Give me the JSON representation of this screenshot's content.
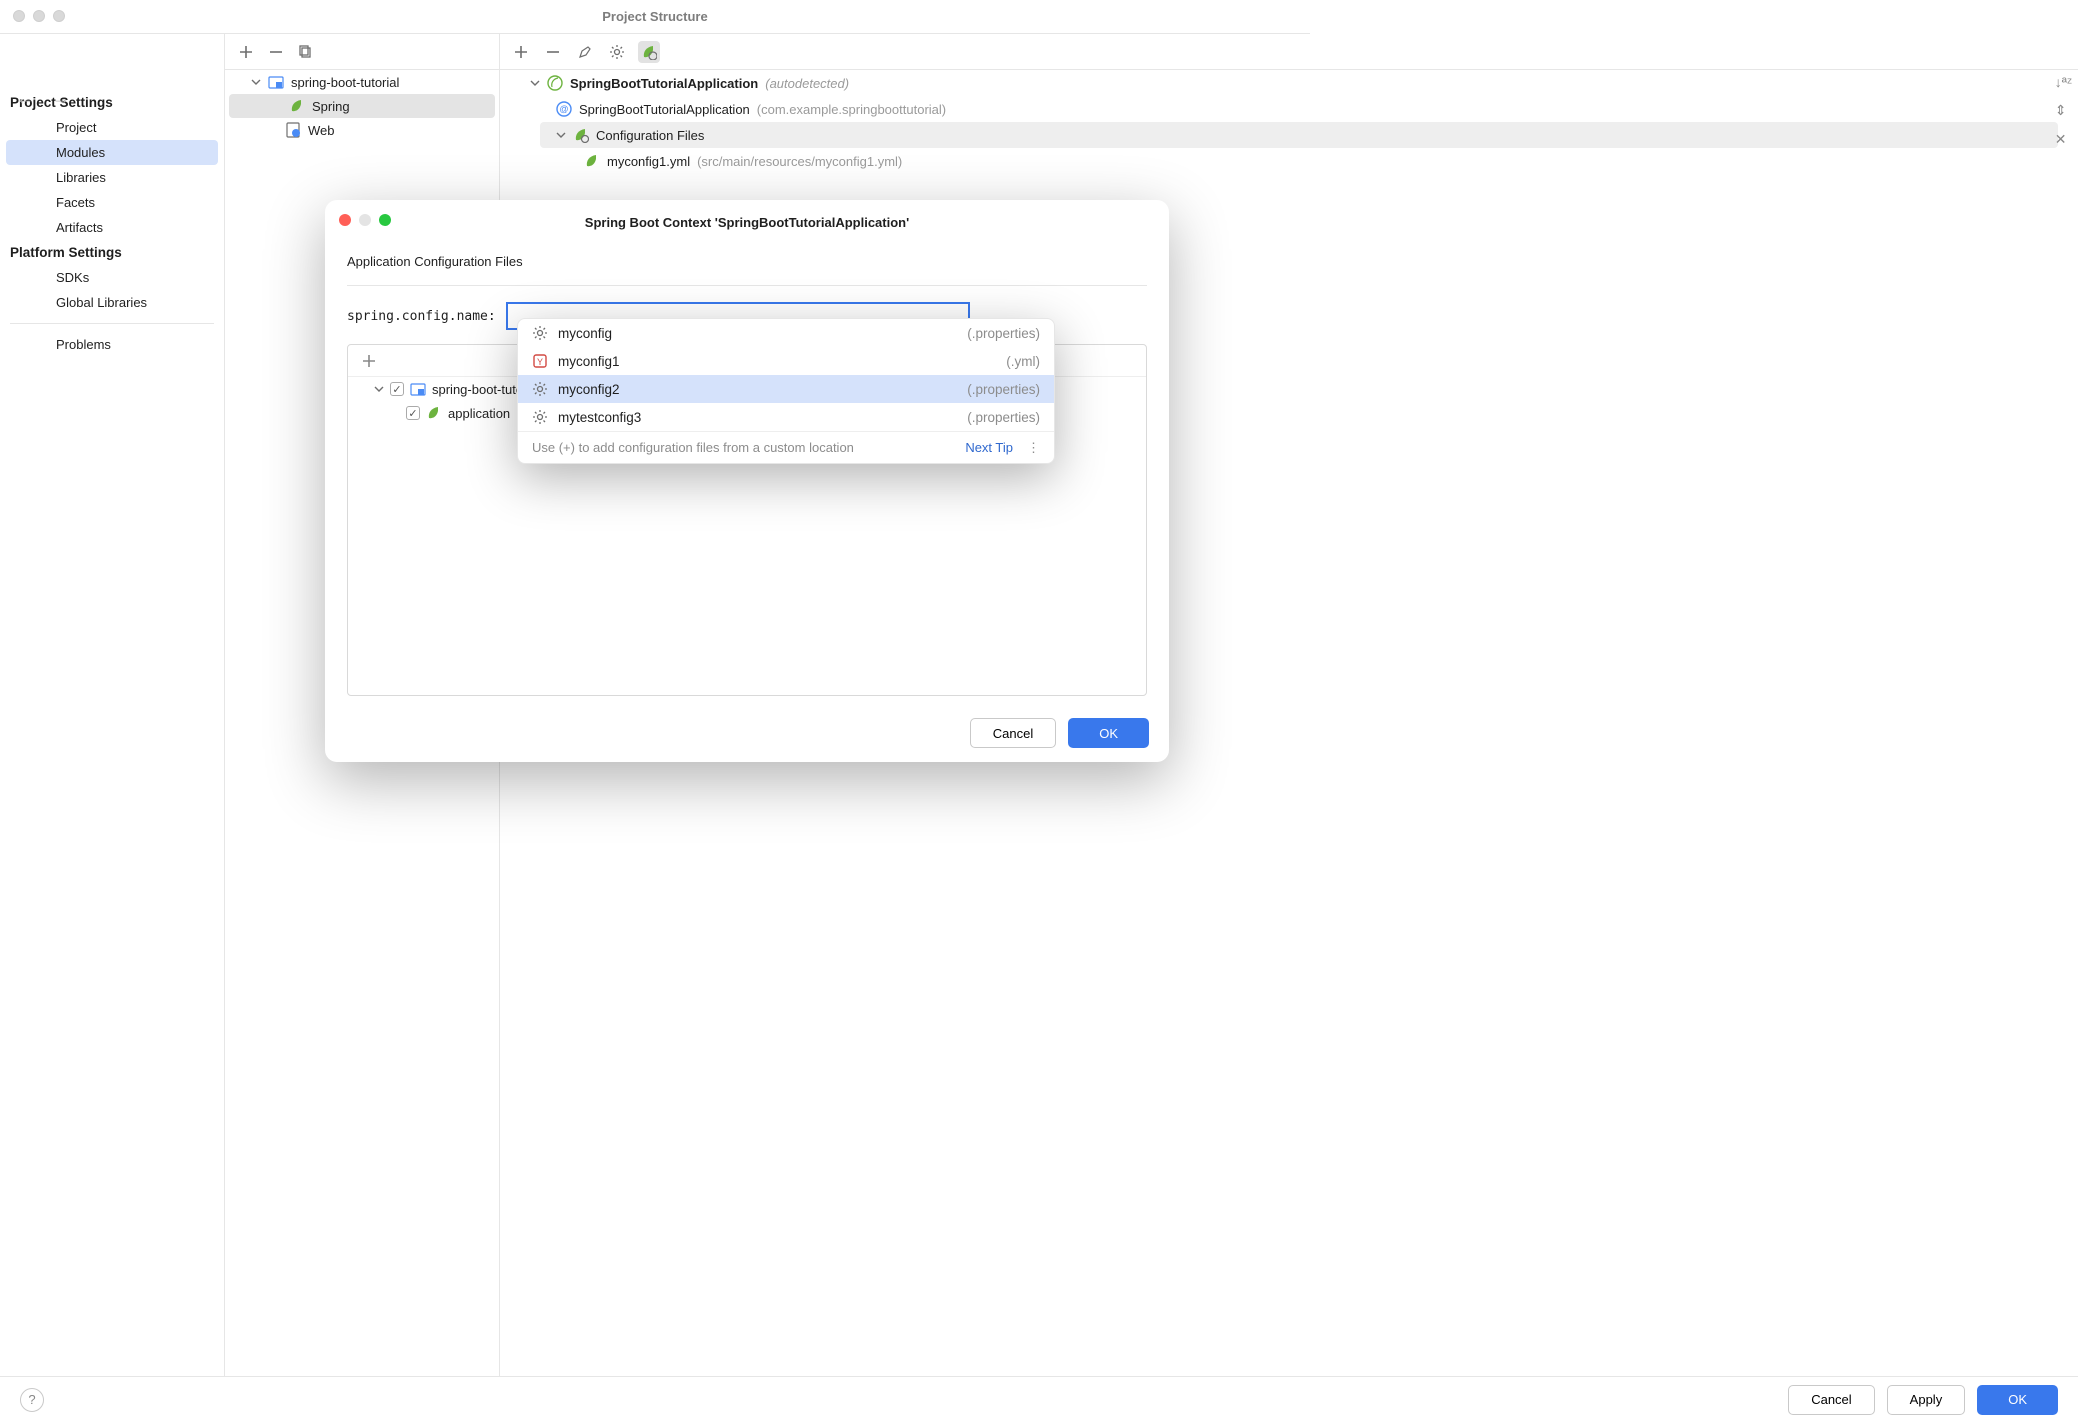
{
  "window": {
    "title": "Project Structure"
  },
  "sidebar": {
    "project_settings_heading": "Project Settings",
    "platform_settings_heading": "Platform Settings",
    "items": {
      "project": "Project",
      "modules": "Modules",
      "libraries": "Libraries",
      "facets": "Facets",
      "artifacts": "Artifacts",
      "sdks": "SDKs",
      "global_libraries": "Global Libraries",
      "problems": "Problems"
    }
  },
  "middle_tree": {
    "root": "spring-boot-tutorial",
    "items": [
      "Spring",
      "Web"
    ]
  },
  "detail": {
    "app_name": "SpringBootTutorialApplication",
    "app_suffix": "(autodetected)",
    "child_name": "SpringBootTutorialApplication",
    "child_pkg": "(com.example.springboottutorial)",
    "config_files_label": "Configuration Files",
    "file_name": "myconfig1.yml",
    "file_path": "(src/main/resources/myconfig1.yml)"
  },
  "modal": {
    "title": "Spring Boot Context 'SpringBootTutorialApplication'",
    "section_label": "Application Configuration Files",
    "config_label": "spring.config.name:",
    "config_value": "",
    "tree_root": "spring-boot-tutorial",
    "tree_file": "application",
    "cancel": "Cancel",
    "ok": "OK"
  },
  "autocomplete": {
    "items": [
      {
        "name": "myconfig",
        "ext": "(.properties)",
        "icon": "gear"
      },
      {
        "name": "myconfig1",
        "ext": "(.yml)",
        "icon": "yml"
      },
      {
        "name": "myconfig2",
        "ext": "(.properties)",
        "icon": "gear",
        "selected": true
      },
      {
        "name": "mytestconfig3",
        "ext": "(.properties)",
        "icon": "gear"
      }
    ],
    "footer_hint": "Use (+) to add configuration files from a custom location",
    "next_tip": "Next Tip"
  },
  "bottom": {
    "cancel": "Cancel",
    "apply": "Apply",
    "ok": "OK"
  }
}
